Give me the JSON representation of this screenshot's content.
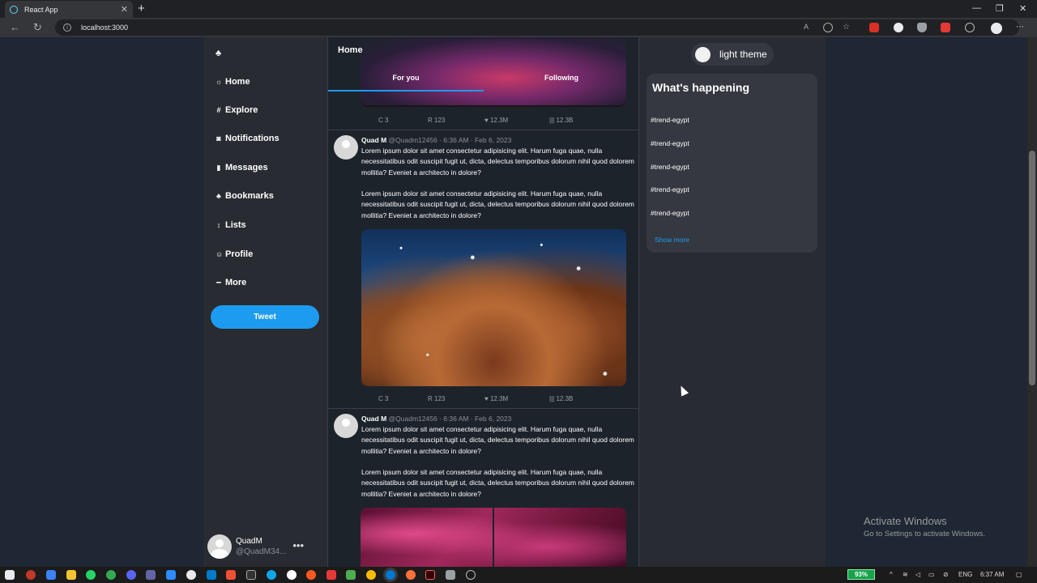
{
  "browser": {
    "tab_title": "React App",
    "tab_close": "✕",
    "new_tab": "+",
    "url": "localhost:3000",
    "win_min": "—",
    "win_max": "❐",
    "win_close": "✕"
  },
  "nav": {
    "logo_icon": "♣",
    "items": [
      {
        "icon": "☼",
        "label": "Home"
      },
      {
        "icon": "#",
        "label": "Explore"
      },
      {
        "icon": "◙",
        "label": "Notifications"
      },
      {
        "icon": "▮",
        "label": "Messages"
      },
      {
        "icon": "♣",
        "label": "Bookmarks"
      },
      {
        "icon": "↕",
        "label": "Lists"
      },
      {
        "icon": "☺",
        "label": "Profile"
      },
      {
        "icon": "━",
        "label": "More"
      }
    ],
    "tweet_button": "Tweet",
    "account": {
      "name": "QuadM",
      "handle": "@QuadM34...",
      "menu": "•••"
    }
  },
  "feed": {
    "title": "Home",
    "tabs": [
      "For you",
      "Following"
    ],
    "stats": {
      "comments": "C 3",
      "retweets": "R 123",
      "likes": "♥ 12.3M",
      "views": "|||  12.3B"
    },
    "posts": [
      {
        "name": "Quad M",
        "handle": "@Quadm12456",
        "time": "· 6:36 AM · Feb 6, 2023",
        "paragraph1": "Lorem ipsum dolor sit amet consectetur adipisicing elit. Harum fuga quae, nulla necessitatibus odit suscipit fugit ut, dicta, delectus temporibus dolorum nihil quod dolorem mollitia? Eveniet a architecto in dolore?",
        "paragraph2": "Lorem ipsum dolor sit amet consectetur adipisicing elit. Harum fuga quae, nulla necessitatibus odit suscipit fugit ut, dicta, delectus temporibus dolorum nihil quod dolorem mollitia? Eveniet a architecto in dolore?"
      },
      {
        "name": "Quad M",
        "handle": "@Quadm12456",
        "time": "· 6:36 AM · Feb 6, 2023",
        "paragraph1": "Lorem ipsum dolor sit amet consectetur adipisicing elit. Harum fuga quae, nulla necessitatibus odit suscipit fugit ut, dicta, delectus temporibus dolorum nihil quod dolorem mollitia? Eveniet a architecto in dolore?",
        "paragraph2": "Lorem ipsum dolor sit amet consectetur adipisicing elit. Harum fuga quae, nulla necessitatibus odit suscipit fugit ut, dicta, delectus temporibus dolorum nihil quod dolorem mollitia? Eveniet a architecto in dolore?"
      }
    ]
  },
  "sidebar": {
    "theme_toggle": "light theme",
    "happening_title": "What's happening",
    "trends": [
      "#trend-egypt",
      "#trend-egypt",
      "#trend-egypt",
      "#trend-egypt",
      "#trend-egypt"
    ],
    "show_more": "Show more"
  },
  "watermark": {
    "title": "Activate Windows",
    "subtitle": "Go to Settings to activate Windows."
  },
  "taskbar": {
    "battery": "93%",
    "language": "ENG",
    "clock": "6:37 AM"
  },
  "colors": {
    "accent": "#1d9bf0",
    "page_bg": "#1e2733",
    "panel_bg": "#282b32"
  }
}
